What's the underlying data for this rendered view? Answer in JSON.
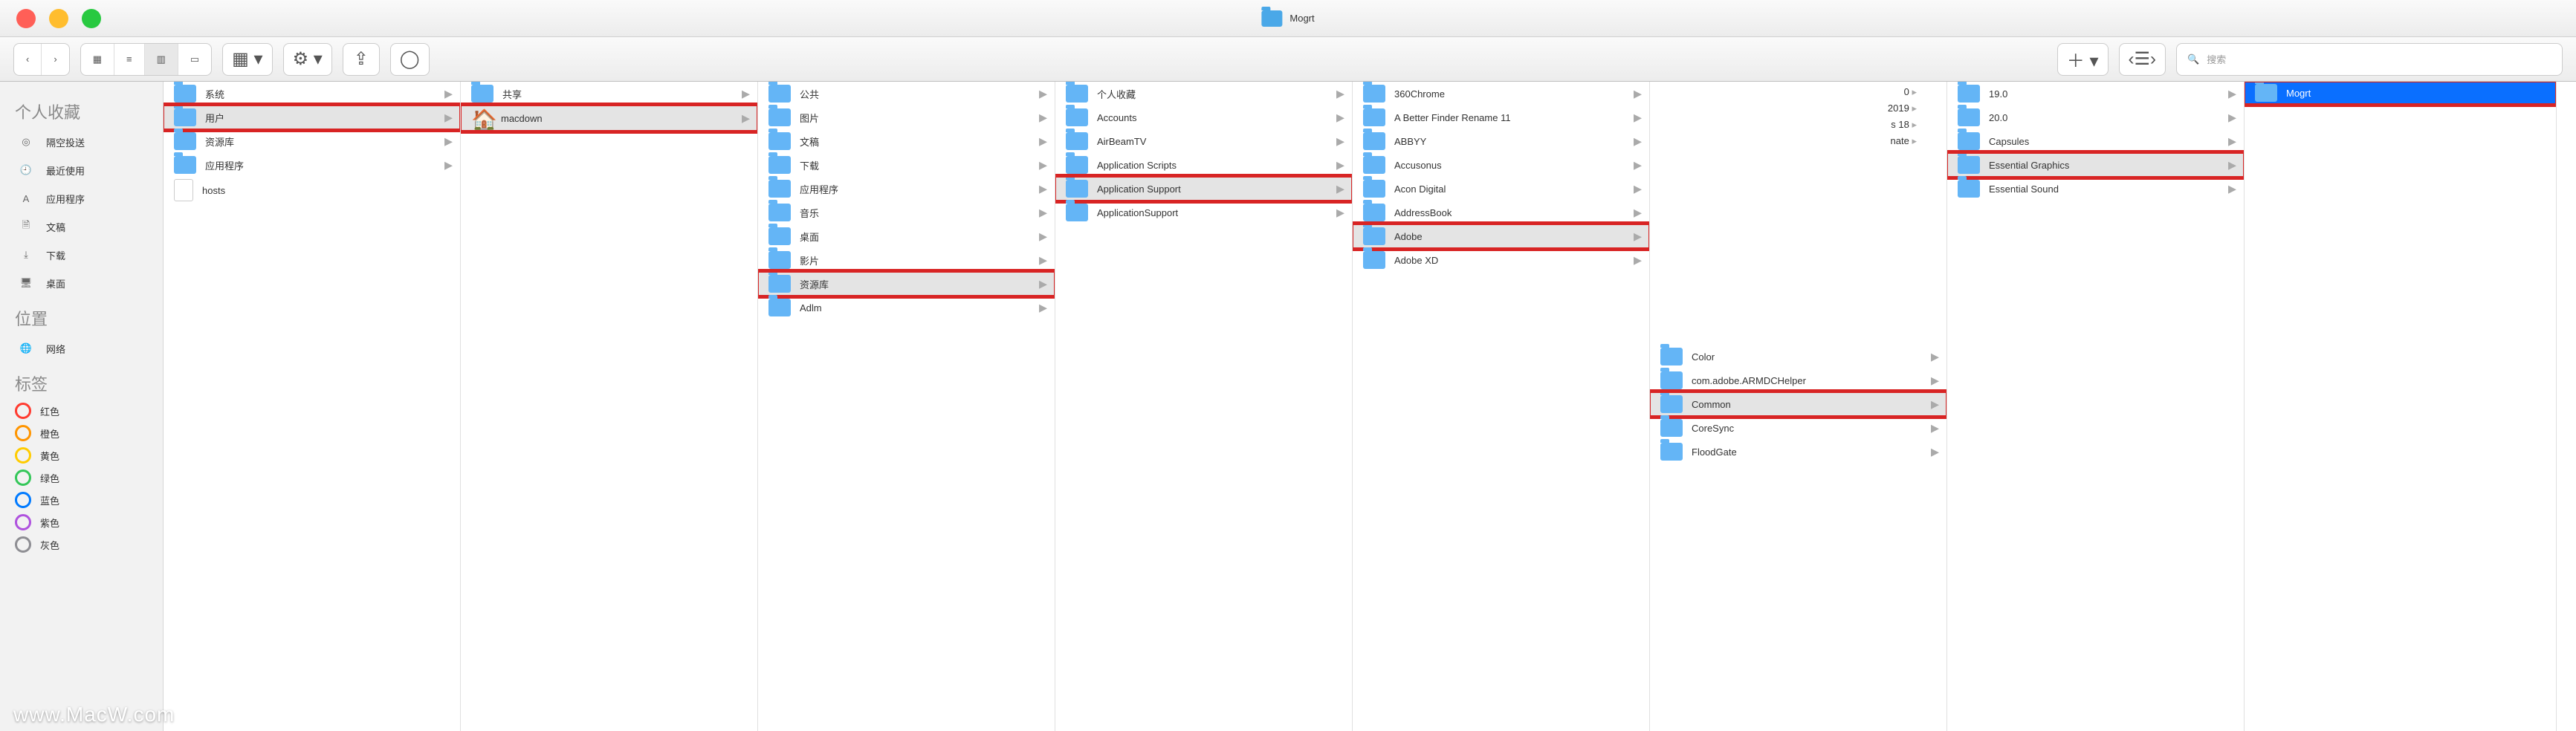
{
  "window": {
    "title": "Mogrt"
  },
  "toolbar": {
    "nav_back": "‹",
    "nav_fwd": "›",
    "view_icons": "▦",
    "view_list": "≡",
    "view_cols": "▥",
    "view_gallery": "▭",
    "group": "▦ ▾",
    "action": "⚙ ▾",
    "share": "⇪",
    "edit_tags": "◯",
    "add": "＋ ▾",
    "sort": "‹☰›",
    "search_placeholder": "搜索",
    "search_icon": "🔍"
  },
  "sidebar": {
    "fav_header": "个人收藏",
    "favs": [
      {
        "icon": "◎",
        "label": "隔空投送"
      },
      {
        "icon": "🕘",
        "label": "最近使用"
      },
      {
        "icon": "A",
        "label": "应用程序"
      },
      {
        "icon": "🗎",
        "label": "文稿"
      },
      {
        "icon": "⤓",
        "label": "下载"
      },
      {
        "icon": "🖥",
        "label": "桌面"
      }
    ],
    "loc_header": "位置",
    "locs": [
      {
        "icon": "🌐",
        "label": "网络"
      }
    ],
    "tag_header": "标签",
    "tags": [
      {
        "cls": "red",
        "label": "红色"
      },
      {
        "cls": "org",
        "label": "橙色"
      },
      {
        "cls": "yel",
        "label": "黄色"
      },
      {
        "cls": "grn",
        "label": "绿色"
      },
      {
        "cls": "blu",
        "label": "蓝色"
      },
      {
        "cls": "pur",
        "label": "紫色"
      },
      {
        "cls": "gry",
        "label": "灰色"
      }
    ]
  },
  "columns": [
    {
      "items": [
        {
          "t": "folder",
          "label": "系统",
          "chev": true
        },
        {
          "t": "folder",
          "label": "用户",
          "chev": true,
          "sel": true,
          "hl": true
        },
        {
          "t": "folder",
          "label": "资源库",
          "chev": true
        },
        {
          "t": "folder",
          "label": "应用程序",
          "chev": true
        },
        {
          "t": "file",
          "label": "hosts"
        }
      ]
    },
    {
      "items": [
        {
          "t": "folder",
          "label": "共享",
          "chev": true
        },
        {
          "t": "home",
          "label": "macdown",
          "chev": true,
          "sel": true,
          "hl": true
        }
      ]
    },
    {
      "items": [
        {
          "t": "folder",
          "label": "公共",
          "chev": true
        },
        {
          "t": "folder",
          "label": "图片",
          "chev": true
        },
        {
          "t": "folder",
          "label": "文稿",
          "chev": true
        },
        {
          "t": "folder",
          "label": "下载",
          "chev": true
        },
        {
          "t": "folder",
          "label": "应用程序",
          "chev": true
        },
        {
          "t": "folder",
          "label": "音乐",
          "chev": true
        },
        {
          "t": "folder",
          "label": "桌面",
          "chev": true
        },
        {
          "t": "folder",
          "label": "影片",
          "chev": true
        },
        {
          "t": "folder",
          "label": "资源库",
          "chev": true,
          "sel": true,
          "hl": true
        },
        {
          "t": "folder",
          "label": "Adlm",
          "chev": true
        }
      ]
    },
    {
      "items": [
        {
          "t": "folder",
          "label": "个人收藏",
          "chev": true
        },
        {
          "t": "folder",
          "label": "Accounts",
          "chev": true
        },
        {
          "t": "folder",
          "label": "AirBeamTV",
          "chev": true
        },
        {
          "t": "folder",
          "label": "Application Scripts",
          "chev": true
        },
        {
          "t": "folder",
          "label": "Application Support",
          "chev": true,
          "sel": true,
          "hl": true
        },
        {
          "t": "folder",
          "label": "ApplicationSupport",
          "chev": true
        }
      ]
    },
    {
      "items": [
        {
          "t": "folder",
          "label": "360Chrome",
          "chev": true
        },
        {
          "t": "folder",
          "label": "A Better Finder Rename 11",
          "chev": true
        },
        {
          "t": "folder",
          "label": "ABBYY",
          "chev": true
        },
        {
          "t": "folder",
          "label": "Accusonus",
          "chev": true
        },
        {
          "t": "folder",
          "label": "Acon Digital",
          "chev": true
        },
        {
          "t": "folder",
          "label": "AddressBook",
          "chev": true
        },
        {
          "t": "folder",
          "label": "Adobe",
          "chev": true,
          "sel": true,
          "hl": true
        },
        {
          "t": "folder",
          "label": "Adobe XD",
          "chev": true
        }
      ]
    },
    {
      "items": [
        {
          "t": "",
          "label": "0",
          "chev": true
        },
        {
          "t": "",
          "label": "2019",
          "chev": true
        },
        {
          "t": "",
          "label": "s 18",
          "chev": true
        },
        {
          "t": "",
          "label": "nate",
          "chev": true
        },
        {
          "t": "folder",
          "label": "Color",
          "chev": true
        },
        {
          "t": "folder",
          "label": "com.adobe.ARMDCHelper",
          "chev": true
        },
        {
          "t": "folder",
          "label": "Common",
          "chev": true,
          "sel": true,
          "hl": true
        },
        {
          "t": "folder",
          "label": "CoreSync",
          "chev": true
        },
        {
          "t": "folder",
          "label": "FloodGate",
          "chev": true
        }
      ]
    },
    {
      "items": [
        {
          "t": "folder",
          "label": "19.0",
          "chev": true
        },
        {
          "t": "folder",
          "label": "20.0",
          "chev": true
        },
        {
          "t": "folder",
          "label": "Capsules",
          "chev": true
        },
        {
          "t": "folder",
          "label": "Essential Graphics",
          "chev": true,
          "sel": true,
          "hl": true
        },
        {
          "t": "folder",
          "label": "Essential Sound",
          "chev": true
        }
      ]
    },
    {
      "items": [
        {
          "t": "folder",
          "label": "Mogrt",
          "chev": false,
          "active": true,
          "hl": true
        }
      ]
    }
  ],
  "watermark": "www.MacW.com"
}
